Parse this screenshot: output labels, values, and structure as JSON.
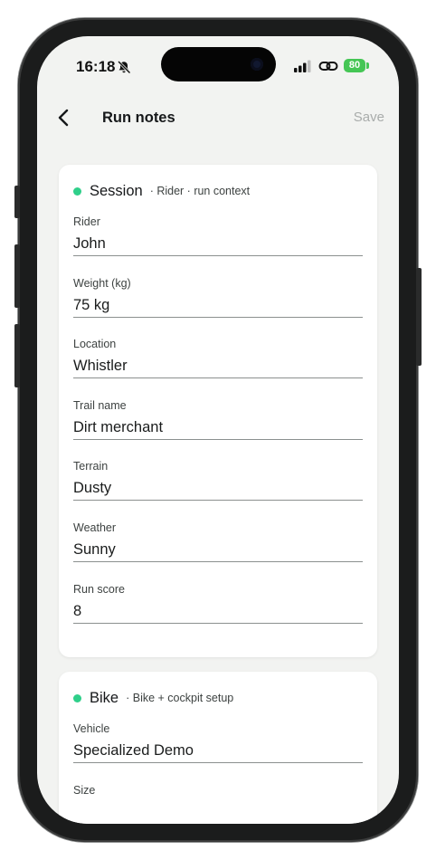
{
  "status_bar": {
    "time": "16:18",
    "battery": "80"
  },
  "nav": {
    "title": "Run notes",
    "save_label": "Save"
  },
  "session_card": {
    "title": "Session",
    "subtitle": "· Rider · run context",
    "fields": [
      {
        "label": "Rider",
        "value": "John"
      },
      {
        "label": "Weight (kg)",
        "value": "75 kg"
      },
      {
        "label": "Location",
        "value": "Whistler"
      },
      {
        "label": "Trail name",
        "value": "Dirt merchant"
      },
      {
        "label": "Terrain",
        "value": "Dusty"
      },
      {
        "label": "Weather",
        "value": "Sunny"
      },
      {
        "label": "Run score",
        "value": "8"
      }
    ]
  },
  "bike_card": {
    "title": "Bike",
    "subtitle": "· Bike + cockpit setup",
    "fields": [
      {
        "label": "Vehicle",
        "value": "Specialized Demo"
      },
      {
        "label": "Size",
        "value": ""
      }
    ]
  },
  "colors": {
    "accent_dot": "#2fcf8a",
    "screen_background": "#f2f3f1",
    "card_background": "#ffffff",
    "battery_green": "#45c655",
    "save_disabled": "#a9acab"
  },
  "icons": [
    "bell-slash-icon",
    "cellular-signal-icon",
    "link-icon",
    "battery-icon",
    "chevron-left-icon"
  ]
}
